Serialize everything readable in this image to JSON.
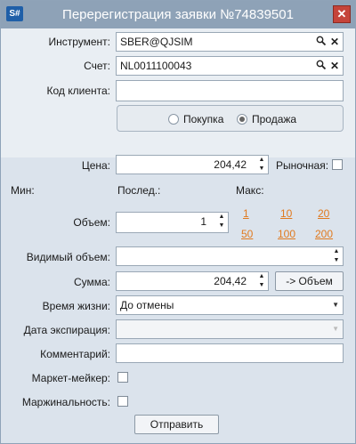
{
  "window": {
    "app_icon": "S#",
    "title": "Перерегистрация заявки №74839501",
    "close": "✕"
  },
  "form": {
    "instrument": {
      "label": "Инструмент:",
      "value": "SBER@QJSIM"
    },
    "account": {
      "label": "Счет:",
      "value": "NL0011100043"
    },
    "client_code": {
      "label": "Код клиента:",
      "value": ""
    },
    "side": {
      "buy": "Покупка",
      "sell": "Продажа",
      "selected": "sell"
    },
    "price": {
      "label": "Цена:",
      "value": "204,42"
    },
    "market": {
      "label": "Рыночная:",
      "checked": false
    },
    "stats": {
      "min": "Мин:",
      "last": "Послед.:",
      "max": "Макс:"
    },
    "volume": {
      "label": "Объем:",
      "value": "1"
    },
    "quick_volumes": [
      "1",
      "10",
      "20",
      "50",
      "100",
      "200"
    ],
    "visible_volume": {
      "label": "Видимый объем:",
      "value": ""
    },
    "sum": {
      "label": "Сумма:",
      "value": "204,42"
    },
    "to_volume_button": "-> Объем",
    "lifetime": {
      "label": "Время жизни:",
      "value": "До отмены"
    },
    "expiry": {
      "label": "Дата экспирация:",
      "value": ""
    },
    "comment": {
      "label": "Комментарий:",
      "value": ""
    },
    "market_maker": {
      "label": "Маркет-мейкер:",
      "checked": false
    },
    "margin": {
      "label": "Маржинальность:",
      "checked": false
    },
    "submit": "Отправить"
  },
  "icons": {
    "search": "🔍",
    "clear": "✕",
    "spin_up": "▲",
    "spin_down": "▼",
    "dropdown": "▼"
  }
}
